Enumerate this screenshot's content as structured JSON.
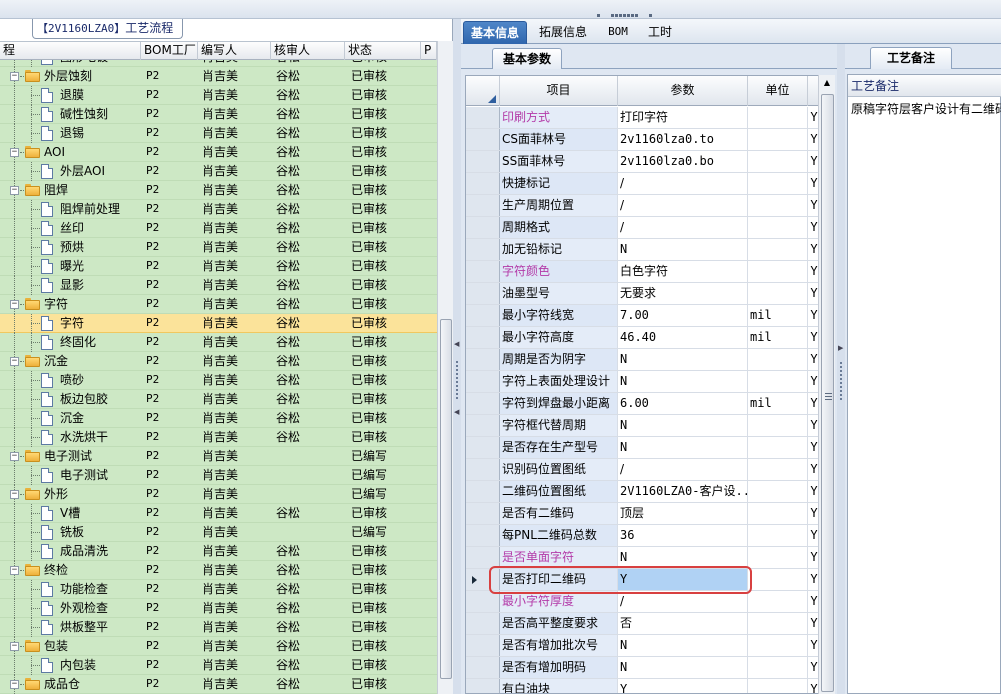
{
  "left_panel": {
    "tab_code": "【2V1160LZA0】",
    "tab_title": "工艺流程",
    "columns": {
      "flow": "程",
      "bom": "BOM工厂",
      "writer": "编写人",
      "reviewer": "核审人",
      "status": "状态",
      "p": "P"
    }
  },
  "tree_rows": [
    {
      "name": "图形电镀",
      "level": 1,
      "bom": "P2",
      "writer": "肖吉美",
      "reviewer": "谷松",
      "status": "已审核"
    },
    {
      "name": "外层蚀刻",
      "level": 0,
      "bom": "P2",
      "writer": "肖吉美",
      "reviewer": "谷松",
      "status": "已审核"
    },
    {
      "name": "退膜",
      "level": 1,
      "bom": "P2",
      "writer": "肖吉美",
      "reviewer": "谷松",
      "status": "已审核"
    },
    {
      "name": "碱性蚀刻",
      "level": 1,
      "bom": "P2",
      "writer": "肖吉美",
      "reviewer": "谷松",
      "status": "已审核"
    },
    {
      "name": "退锡",
      "level": 1,
      "bom": "P2",
      "writer": "肖吉美",
      "reviewer": "谷松",
      "status": "已审核"
    },
    {
      "name": "AOI",
      "level": 0,
      "bom": "P2",
      "writer": "肖吉美",
      "reviewer": "谷松",
      "status": "已审核"
    },
    {
      "name": "外层AOI",
      "level": 1,
      "bom": "P2",
      "writer": "肖吉美",
      "reviewer": "谷松",
      "status": "已审核"
    },
    {
      "name": "阻焊",
      "level": 0,
      "bom": "P2",
      "writer": "肖吉美",
      "reviewer": "谷松",
      "status": "已审核"
    },
    {
      "name": "阻焊前处理",
      "level": 1,
      "bom": "P2",
      "writer": "肖吉美",
      "reviewer": "谷松",
      "status": "已审核"
    },
    {
      "name": "丝印",
      "level": 1,
      "bom": "P2",
      "writer": "肖吉美",
      "reviewer": "谷松",
      "status": "已审核"
    },
    {
      "name": "预烘",
      "level": 1,
      "bom": "P2",
      "writer": "肖吉美",
      "reviewer": "谷松",
      "status": "已审核"
    },
    {
      "name": "曝光",
      "level": 1,
      "bom": "P2",
      "writer": "肖吉美",
      "reviewer": "谷松",
      "status": "已审核"
    },
    {
      "name": "显影",
      "level": 1,
      "bom": "P2",
      "writer": "肖吉美",
      "reviewer": "谷松",
      "status": "已审核"
    },
    {
      "name": "字符",
      "level": 0,
      "bom": "P2",
      "writer": "肖吉美",
      "reviewer": "谷松",
      "status": "已审核"
    },
    {
      "name": "字符",
      "level": 1,
      "bom": "P2",
      "writer": "肖吉美",
      "reviewer": "谷松",
      "status": "已审核",
      "selected": true
    },
    {
      "name": "终固化",
      "level": 1,
      "bom": "P2",
      "writer": "肖吉美",
      "reviewer": "谷松",
      "status": "已审核"
    },
    {
      "name": "沉金",
      "level": 0,
      "bom": "P2",
      "writer": "肖吉美",
      "reviewer": "谷松",
      "status": "已审核"
    },
    {
      "name": "喷砂",
      "level": 1,
      "bom": "P2",
      "writer": "肖吉美",
      "reviewer": "谷松",
      "status": "已审核"
    },
    {
      "name": "板边包胶",
      "level": 1,
      "bom": "P2",
      "writer": "肖吉美",
      "reviewer": "谷松",
      "status": "已审核"
    },
    {
      "name": "沉金",
      "level": 1,
      "bom": "P2",
      "writer": "肖吉美",
      "reviewer": "谷松",
      "status": "已审核"
    },
    {
      "name": "水洗烘干",
      "level": 1,
      "bom": "P2",
      "writer": "肖吉美",
      "reviewer": "谷松",
      "status": "已审核"
    },
    {
      "name": "电子测试",
      "level": 0,
      "bom": "P2",
      "writer": "肖吉美",
      "reviewer": "",
      "status": "已编写"
    },
    {
      "name": "电子测试",
      "level": 1,
      "bom": "P2",
      "writer": "肖吉美",
      "reviewer": "",
      "status": "已编写"
    },
    {
      "name": "外形",
      "level": 0,
      "bom": "P2",
      "writer": "肖吉美",
      "reviewer": "",
      "status": "已编写"
    },
    {
      "name": "V槽",
      "level": 1,
      "bom": "P2",
      "writer": "肖吉美",
      "reviewer": "谷松",
      "status": "已审核"
    },
    {
      "name": "铣板",
      "level": 1,
      "bom": "P2",
      "writer": "肖吉美",
      "reviewer": "",
      "status": "已编写"
    },
    {
      "name": "成品清洗",
      "level": 1,
      "bom": "P2",
      "writer": "肖吉美",
      "reviewer": "谷松",
      "status": "已审核"
    },
    {
      "name": "终检",
      "level": 0,
      "bom": "P2",
      "writer": "肖吉美",
      "reviewer": "谷松",
      "status": "已审核"
    },
    {
      "name": "功能检查",
      "level": 1,
      "bom": "P2",
      "writer": "肖吉美",
      "reviewer": "谷松",
      "status": "已审核"
    },
    {
      "name": "外观检查",
      "level": 1,
      "bom": "P2",
      "writer": "肖吉美",
      "reviewer": "谷松",
      "status": "已审核"
    },
    {
      "name": "烘板整平",
      "level": 1,
      "bom": "P2",
      "writer": "肖吉美",
      "reviewer": "谷松",
      "status": "已审核"
    },
    {
      "name": "包装",
      "level": 0,
      "bom": "P2",
      "writer": "肖吉美",
      "reviewer": "谷松",
      "status": "已审核"
    },
    {
      "name": "内包装",
      "level": 1,
      "bom": "P2",
      "writer": "肖吉美",
      "reviewer": "谷松",
      "status": "已审核"
    },
    {
      "name": "成品仓",
      "level": 0,
      "bom": "P2",
      "writer": "肖吉美",
      "reviewer": "谷松",
      "status": "已审核"
    }
  ],
  "tabs": [
    "基本信息",
    "拓展信息",
    "BOM",
    "工时"
  ],
  "sub_tab": "基本参数",
  "grid_headers": {
    "item": "项目",
    "param": "参数",
    "unit": "单位"
  },
  "grid_rows": [
    {
      "item": "印刷方式",
      "param": "打印字符",
      "unit": "",
      "flag": "Y",
      "pink": true
    },
    {
      "item": "CS面菲林号",
      "param": "2v1160lza0.to",
      "unit": "",
      "flag": "Y",
      "mono": true
    },
    {
      "item": "SS面菲林号",
      "param": "2v1160lza0.bo",
      "unit": "",
      "flag": "Y",
      "mono": true
    },
    {
      "item": "快捷标记",
      "param": "/",
      "unit": "",
      "flag": "Y"
    },
    {
      "item": "生产周期位置",
      "param": "/",
      "unit": "",
      "flag": "Y"
    },
    {
      "item": "周期格式",
      "param": "/",
      "unit": "",
      "flag": "Y"
    },
    {
      "item": "加无铅标记",
      "param": "N",
      "unit": "",
      "flag": "Y",
      "mono": true
    },
    {
      "item": "字符颜色",
      "param": "白色字符",
      "unit": "",
      "flag": "Y",
      "pink": true
    },
    {
      "item": "油墨型号",
      "param": "无要求",
      "unit": "",
      "flag": "Y"
    },
    {
      "item": "最小字符线宽",
      "param": "7.00",
      "unit": "mil",
      "flag": "Y",
      "mono": true
    },
    {
      "item": "最小字符高度",
      "param": "46.40",
      "unit": "mil",
      "flag": "Y",
      "mono": true
    },
    {
      "item": "周期是否为阴字",
      "param": "N",
      "unit": "",
      "flag": "Y",
      "mono": true
    },
    {
      "item": "字符上表面处理设计",
      "param": "N",
      "unit": "",
      "flag": "Y",
      "mono": true
    },
    {
      "item": "字符到焊盘最小距离",
      "param": "6.00",
      "unit": "mil",
      "flag": "Y",
      "mono": true
    },
    {
      "item": "字符框代替周期",
      "param": "N",
      "unit": "",
      "flag": "Y",
      "mono": true
    },
    {
      "item": "是否存在生产型号",
      "param": "N",
      "unit": "",
      "flag": "Y",
      "mono": true
    },
    {
      "item": "识别码位置图纸",
      "param": "/",
      "unit": "",
      "flag": "Y"
    },
    {
      "item": "二维码位置图纸",
      "param": "2V1160LZA0-客户设...",
      "unit": "",
      "flag": "Y",
      "mono": true
    },
    {
      "item": "是否有二维码",
      "param": "顶层",
      "unit": "",
      "flag": "Y"
    },
    {
      "item": "每PNL二维码总数",
      "param": "36",
      "unit": "",
      "flag": "Y",
      "mono": true
    },
    {
      "item": "是否单面字符",
      "param": "N",
      "unit": "",
      "flag": "Y",
      "pink": true,
      "mono": true
    },
    {
      "item": "是否打印二维码",
      "param": "Y",
      "unit": "",
      "flag": "Y",
      "mono": true,
      "current": true
    },
    {
      "item": "最小字符厚度",
      "param": "/",
      "unit": "",
      "flag": "Y",
      "pink": true
    },
    {
      "item": "是否高平整度要求",
      "param": "否",
      "unit": "",
      "flag": "Y"
    },
    {
      "item": "是否有增加批次号",
      "param": "N",
      "unit": "",
      "flag": "Y",
      "mono": true
    },
    {
      "item": "是否有增加明码",
      "param": "N",
      "unit": "",
      "flag": "Y",
      "mono": true
    },
    {
      "item": "有白油块",
      "param": "Y",
      "unit": "",
      "flag": "Y",
      "mono": true
    }
  ],
  "right_panel": {
    "tab": "工艺备注",
    "header": "工艺备注",
    "text": "原稿字符层客户设计有二维码"
  },
  "colors": {
    "highlight_box": "#d84040",
    "tree_bg": "#cde8c5",
    "selected_row": "#fbe39a",
    "pink_label": "#b33aa8"
  }
}
